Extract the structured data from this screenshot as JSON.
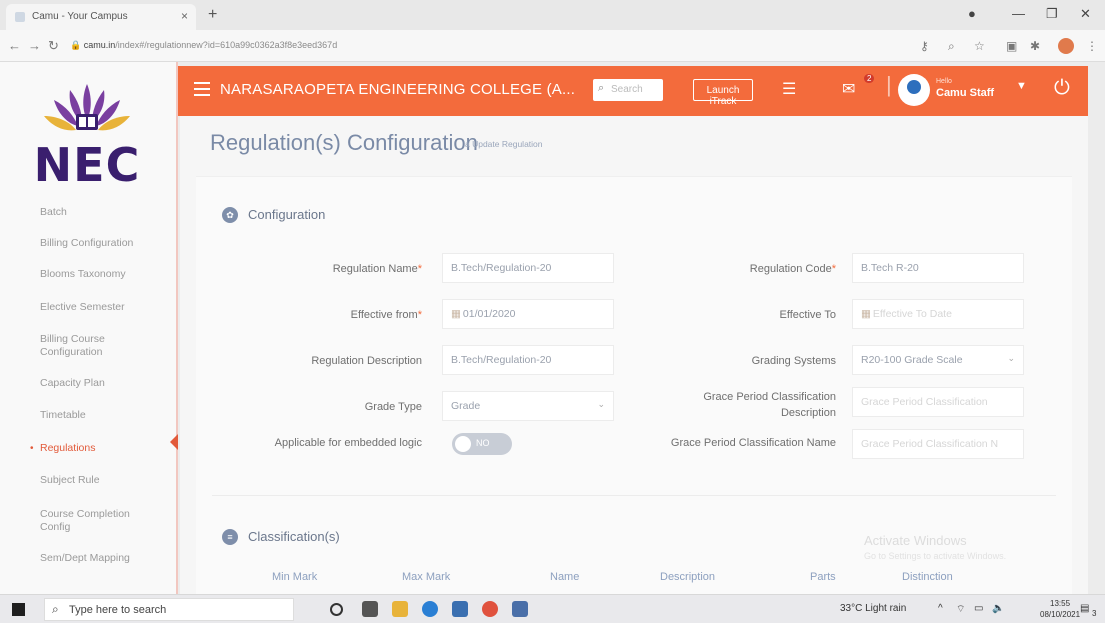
{
  "browser": {
    "tab_title": "Camu - Your Campus",
    "tab_close": "×",
    "new_tab": "+",
    "url_domain": "camu.in",
    "url_path": "/index#/regulationnew?id=610a99c0362a3f8e3eed367d"
  },
  "sidebar": {
    "logo_text": "NEC",
    "items": [
      {
        "label": "Batch"
      },
      {
        "label": "Billing Configuration"
      },
      {
        "label": "Blooms Taxonomy"
      },
      {
        "label": "Elective Semester"
      },
      {
        "label": "Billing Course Configuration"
      },
      {
        "label": "Capacity Plan"
      },
      {
        "label": "Timetable"
      },
      {
        "label": "Regulations",
        "active": true
      },
      {
        "label": "Subject Rule"
      },
      {
        "label": "Course Completion Config"
      },
      {
        "label": "Sem/Dept Mapping"
      }
    ]
  },
  "header": {
    "college_name": "NARASARAOPETA ENGINEERING COLLEGE (A...",
    "search_placeholder": "Search",
    "launch_button": "Launch iTrack",
    "mail_count": "2",
    "greeting": "Hello",
    "user_name": "Camu Staff"
  },
  "page": {
    "title": "Regulation(s) Configuration",
    "subtitle": "a Update Regulation"
  },
  "configuration": {
    "section_title": "Configuration",
    "regulation_name_label": "Regulation Name",
    "regulation_name_value": "B.Tech/Regulation-20",
    "regulation_code_label": "Regulation Code",
    "regulation_code_value": "B.Tech R-20",
    "effective_from_label": "Effective from",
    "effective_from_value": "01/01/2020",
    "effective_to_label": "Effective To",
    "effective_to_placeholder": "Effective To Date",
    "regulation_description_label": "Regulation Description",
    "regulation_description_value": "B.Tech/Regulation-20",
    "grading_systems_label": "Grading Systems",
    "grading_systems_value": "R20-100 Grade Scale",
    "grade_type_label": "Grade Type",
    "grade_type_value": "Grade",
    "grace_desc_label": "Grace Period Classification Description",
    "grace_desc_placeholder": "Grace Period Classification",
    "applicable_label": "Applicable for embedded logic",
    "applicable_toggle": "NO",
    "grace_name_label": "Grace Period Classification Name",
    "grace_name_placeholder": "Grace Period Classification N"
  },
  "classification": {
    "section_title": "Classification(s)",
    "columns": [
      "Min Mark",
      "Max Mark",
      "Name",
      "Description",
      "Parts",
      "Distinction"
    ]
  },
  "watermark": {
    "title": "Activate Windows",
    "body": "Go to Settings to activate Windows."
  },
  "taskbar": {
    "search_placeholder": "Type here to search",
    "weather": "33°C  Light rain",
    "time": "13:55",
    "date": "08/10/2021",
    "notification_count": "3"
  },
  "colors": {
    "brand_orange": "#f36b3c",
    "active_red": "#e25a3a",
    "heading_blue": "#7a8aa6"
  }
}
